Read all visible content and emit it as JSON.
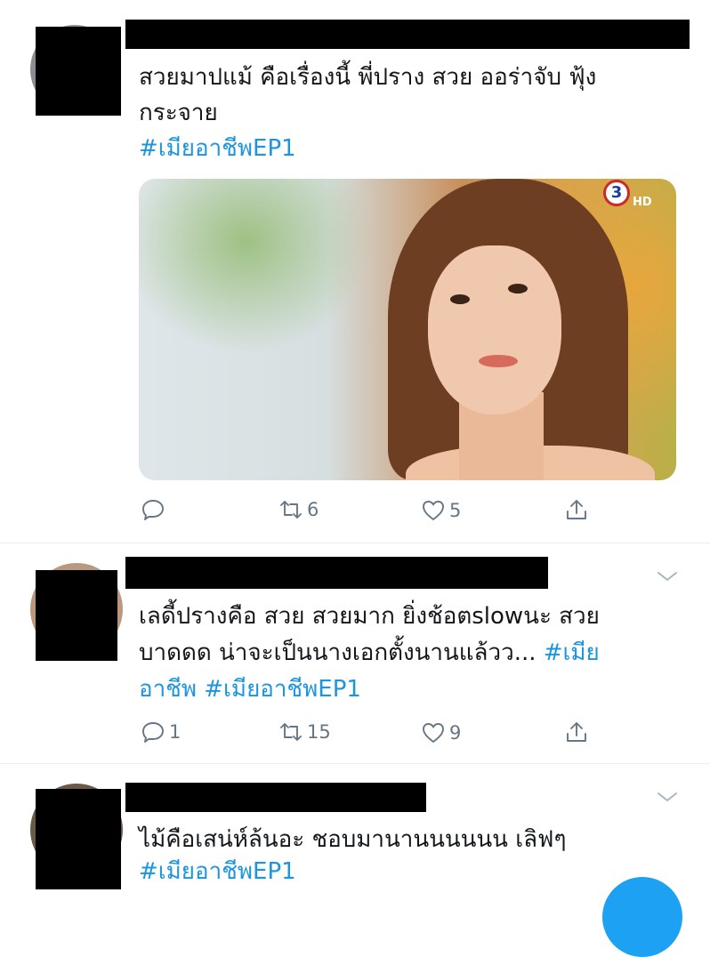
{
  "tweets": [
    {
      "text_lines": [
        "สวยมาปแม้ คือเรื่องนี้ พี่ปราง สวย ออร่าจับ ฟุ้ง",
        "กระจาย"
      ],
      "hashtag": "#เมียอาชีพEP1",
      "media": {
        "channel": "3",
        "badge": "HD"
      },
      "reply_count": "",
      "retweet_count": "6",
      "like_count": "5"
    },
    {
      "text_line1": "เลดี้ปรางคือ สวย สวยมาก ยิ่งช้อตslowนะ สวย",
      "text_line2_plain": "บาดดด น่าจะเป็นนางเอกตั้งนานแล้วว... ",
      "text_line2_tag": "#เมีย",
      "text_line3": "อาชีพ #เมียอาชีพEP1",
      "reply_count": "1",
      "retweet_count": "15",
      "like_count": "9"
    },
    {
      "text_line1": "ไม้คือเสน่ห์ล้นอะ ชอบมานานนนนนน เลิฟๆ",
      "hashtag": "#เมียอาชีพEP1"
    }
  ],
  "icons": {
    "reply": "reply-icon",
    "retweet": "retweet-icon",
    "like": "heart-icon",
    "share": "share-icon",
    "more": "chevron-down-icon"
  },
  "colors": {
    "link": "#1b95e0",
    "icon": "#657786",
    "divider": "#e6ecf0",
    "fab": "#1da1f2"
  }
}
